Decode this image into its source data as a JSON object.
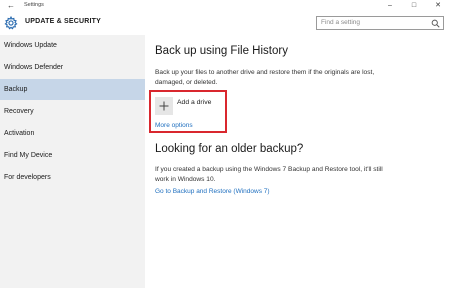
{
  "window": {
    "back_glyph": "←",
    "title": "Settings",
    "minimize_glyph": "–",
    "maximize_glyph": "□",
    "close_glyph": "✕"
  },
  "header": {
    "icon": "gear-icon",
    "title": "UPDATE & SECURITY",
    "search_placeholder": "Find a setting",
    "search_icon": "search-icon"
  },
  "sidebar": {
    "items": [
      {
        "label": "Windows Update",
        "active": false
      },
      {
        "label": "Windows Defender",
        "active": false
      },
      {
        "label": "Backup",
        "active": true
      },
      {
        "label": "Recovery",
        "active": false
      },
      {
        "label": "Activation",
        "active": false
      },
      {
        "label": "Find My Device",
        "active": false
      },
      {
        "label": "For developers",
        "active": false
      }
    ],
    "active_color": "#c6d6e8"
  },
  "main": {
    "file_history": {
      "title": "Back up using File History",
      "description": "Back up your files to another drive and restore them if the originals are lost, damaged, or deleted.",
      "add_drive_label": "Add a drive",
      "add_drive_icon": "plus-icon",
      "more_options": "More options"
    },
    "older_backup": {
      "title": "Looking for an older backup?",
      "description": "If you created a backup using the Windows 7 Backup and Restore tool, it'll still work in Windows 10.",
      "link": "Go to Backup and Restore (Windows 7)"
    }
  },
  "colors": {
    "highlight": "#d9272e",
    "link": "#1f6fbf",
    "sidebar_bg": "#f2f2f2"
  }
}
